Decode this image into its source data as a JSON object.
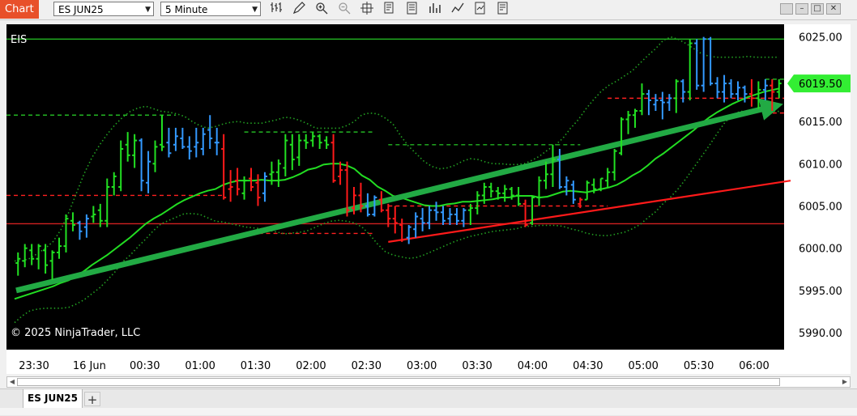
{
  "toolbar": {
    "chart_label": "Chart",
    "instrument_select": "ES JUN25",
    "interval_select": "5 Minute",
    "tools": [
      "bar-type-icon",
      "draw-icon",
      "zoom-in-icon",
      "zoom-out-icon",
      "crosshair-icon",
      "data-box-icon",
      "properties-icon",
      "chart-trader-icon",
      "indicators-icon",
      "strategies-icon",
      "templates-icon"
    ]
  },
  "window_controls": [
    "restore-icon",
    "minimize-icon",
    "maximize-icon",
    "close-icon"
  ],
  "bottom_tabs": {
    "active": "ES JUN25",
    "add_label": "+"
  },
  "chart_data": {
    "type": "candlestick",
    "instrument_label": "EIS",
    "copyright": "© 2025 NinjaTrader, LLC",
    "current_price": "6019.50",
    "colors": {
      "up": "#22e022",
      "down": "#ff1a1a",
      "inside": "#3399ff",
      "background": "#000000",
      "bollinger": "#22a022",
      "sma": "#22dd22"
    },
    "y_ticks": [
      "6025.00",
      "6015.00",
      "6010.00",
      "6005.00",
      "6000.00",
      "5995.00",
      "5990.00"
    ],
    "y_tick_values": [
      6025,
      6015,
      6010,
      6005,
      6000,
      5995,
      5990
    ],
    "ylim": [
      5988,
      6026.5
    ],
    "x_ticks": [
      "23:30",
      "16 Jun",
      "00:30",
      "01:00",
      "01:30",
      "02:00",
      "02:30",
      "03:00",
      "03:30",
      "04:00",
      "04:30",
      "05:00",
      "05:30",
      "06:00"
    ],
    "bars": [
      [
        5998.25,
        5999.5,
        5996.75,
        5998.75,
        "up"
      ],
      [
        5998.5,
        6000.5,
        5997.75,
        6000.0,
        "up"
      ],
      [
        5999.75,
        6000.5,
        5998.0,
        5998.75,
        "up"
      ],
      [
        5998.75,
        6000.5,
        5997.5,
        6000.25,
        "up"
      ],
      [
        5999.75,
        6000.5,
        5997.0,
        5998.0,
        "up"
      ],
      [
        5998.5,
        5999.75,
        5996.25,
        5999.5,
        "up"
      ],
      [
        5999.5,
        6001.25,
        5998.75,
        6000.25,
        "up"
      ],
      [
        6000.25,
        6004.0,
        5999.5,
        6003.5,
        "up"
      ],
      [
        6003.25,
        6004.25,
        6002.0,
        6002.75,
        "up"
      ],
      [
        6003.0,
        6003.25,
        6001.0,
        6002.0,
        "inside"
      ],
      [
        6002.5,
        6004.0,
        6001.25,
        6003.5,
        "inside"
      ],
      [
        6003.75,
        6005.0,
        6003.0,
        6004.0,
        "up"
      ],
      [
        6004.5,
        6005.25,
        6002.5,
        6003.25,
        "up"
      ],
      [
        6003.25,
        6008.25,
        6002.5,
        6007.25,
        "up"
      ],
      [
        6007.25,
        6009.0,
        6006.25,
        6008.5,
        "up"
      ],
      [
        6007.25,
        6012.75,
        6006.75,
        6011.75,
        "up"
      ],
      [
        6012.25,
        6013.75,
        6010.25,
        6011.0,
        "up"
      ],
      [
        6011.0,
        6013.5,
        6009.5,
        6012.75,
        "up"
      ],
      [
        6012.75,
        6013.0,
        6006.75,
        6008.0,
        "inside"
      ],
      [
        6007.75,
        6011.5,
        6006.5,
        6010.25,
        "inside"
      ],
      [
        6010.0,
        6012.75,
        6009.0,
        6012.0,
        "up"
      ],
      [
        6012.25,
        6015.75,
        6011.5,
        6012.0,
        "up"
      ],
      [
        6012.5,
        6014.25,
        6010.75,
        6011.25,
        "inside"
      ],
      [
        6012.25,
        6014.25,
        6011.5,
        6013.25,
        "inside"
      ],
      [
        6013.0,
        6014.25,
        6011.75,
        6012.0,
        "inside"
      ],
      [
        6012.0,
        6013.25,
        6010.5,
        6011.5,
        "inside"
      ],
      [
        6012.0,
        6014.25,
        6010.75,
        6012.5,
        "inside"
      ],
      [
        6011.75,
        6014.25,
        6011.0,
        6013.5,
        "inside"
      ],
      [
        6014.0,
        6015.75,
        6011.75,
        6013.0,
        "inside"
      ],
      [
        6012.5,
        6014.25,
        6011.0,
        6012.5,
        "inside"
      ],
      [
        6011.75,
        6013.5,
        6005.75,
        6006.0,
        "down"
      ],
      [
        6007.0,
        6009.25,
        6005.5,
        6007.25,
        "down"
      ],
      [
        6008.0,
        6009.5,
        6006.25,
        6007.0,
        "down"
      ],
      [
        6006.5,
        6008.5,
        6005.75,
        6008.0,
        "up"
      ],
      [
        6008.25,
        6009.5,
        6006.75,
        6007.25,
        "down"
      ],
      [
        6007.75,
        6008.75,
        6005.0,
        6006.0,
        "down"
      ],
      [
        6006.5,
        6009.0,
        6005.5,
        6008.5,
        "inside"
      ],
      [
        6008.75,
        6010.25,
        6007.5,
        6009.0,
        "up"
      ],
      [
        6009.0,
        6010.5,
        6007.25,
        6010.0,
        "up"
      ],
      [
        6009.5,
        6013.5,
        6008.5,
        6012.75,
        "up"
      ],
      [
        6012.25,
        6013.5,
        6009.25,
        6010.5,
        "up"
      ],
      [
        6010.75,
        6013.5,
        6009.75,
        6012.75,
        "up"
      ],
      [
        6012.75,
        6013.5,
        6011.75,
        6012.5,
        "up"
      ],
      [
        6012.75,
        6013.75,
        6012.0,
        6013.25,
        "up"
      ],
      [
        6013.25,
        6013.5,
        6011.75,
        6012.5,
        "up"
      ],
      [
        6012.75,
        6013.25,
        6011.75,
        6012.25,
        "up"
      ],
      [
        6012.5,
        6013.5,
        6007.75,
        6008.0,
        "down"
      ],
      [
        6008.5,
        6010.25,
        6007.5,
        6009.25,
        "down"
      ],
      [
        6009.25,
        6010.25,
        6003.75,
        6004.5,
        "down"
      ],
      [
        6004.75,
        6007.25,
        6004.0,
        6006.25,
        "down"
      ],
      [
        6006.25,
        6007.75,
        6004.25,
        6005.0,
        "down"
      ],
      [
        6005.0,
        6006.5,
        6003.75,
        6004.0,
        "inside"
      ],
      [
        6004.0,
        6006.25,
        6003.75,
        6006.0,
        "inside"
      ],
      [
        6005.75,
        6006.75,
        6004.25,
        6004.5,
        "down"
      ],
      [
        6004.5,
        6005.25,
        6002.5,
        6003.5,
        "down"
      ],
      [
        6003.5,
        6005.0,
        6001.75,
        6003.0,
        "down"
      ],
      [
        6002.75,
        6003.5,
        6000.75,
        6001.0,
        "down"
      ],
      [
        6001.25,
        6002.75,
        6000.5,
        6002.5,
        "inside"
      ],
      [
        6002.25,
        6004.25,
        6001.25,
        6003.75,
        "inside"
      ],
      [
        6003.5,
        6004.75,
        6002.0,
        6003.0,
        "inside"
      ],
      [
        6003.0,
        6005.0,
        6002.25,
        6004.5,
        "inside"
      ],
      [
        6004.5,
        6005.5,
        6003.25,
        6004.25,
        "inside"
      ],
      [
        6004.25,
        6005.0,
        6002.75,
        6003.25,
        "inside"
      ],
      [
        6003.5,
        6004.75,
        6002.75,
        6004.0,
        "inside"
      ],
      [
        6004.0,
        6004.75,
        6002.75,
        6003.25,
        "inside"
      ],
      [
        6003.25,
        6004.75,
        6002.5,
        6004.5,
        "inside"
      ],
      [
        6004.5,
        6005.25,
        6002.75,
        6004.75,
        "up"
      ],
      [
        6004.75,
        6006.75,
        6004.0,
        6006.25,
        "up"
      ],
      [
        6006.25,
        6007.75,
        6005.25,
        6007.25,
        "up"
      ],
      [
        6007.25,
        6007.75,
        6006.0,
        6006.75,
        "up"
      ],
      [
        6006.75,
        6007.25,
        6005.75,
        6006.5,
        "up"
      ],
      [
        6006.5,
        6007.5,
        6005.5,
        6007.0,
        "up"
      ],
      [
        6007.0,
        6007.25,
        6005.75,
        6006.25,
        "up"
      ],
      [
        6006.25,
        6007.25,
        6005.0,
        6005.25,
        "up"
      ],
      [
        6005.25,
        6005.75,
        6002.5,
        6002.75,
        "down"
      ],
      [
        6003.0,
        6006.25,
        6002.75,
        6006.0,
        "up"
      ],
      [
        6006.0,
        6008.5,
        6005.0,
        6008.0,
        "up"
      ],
      [
        6008.0,
        6010.25,
        6007.0,
        6008.75,
        "up"
      ],
      [
        6008.75,
        6012.25,
        6007.25,
        6010.5,
        "up"
      ],
      [
        6010.5,
        6011.75,
        6007.0,
        6007.25,
        "inside"
      ],
      [
        6007.25,
        6008.5,
        6006.25,
        6008.0,
        "inside"
      ],
      [
        6007.5,
        6008.0,
        6005.25,
        6005.75,
        "inside"
      ],
      [
        6005.25,
        6006.0,
        6004.75,
        6005.75,
        "down"
      ],
      [
        6005.75,
        6008.0,
        6005.75,
        6007.75,
        "up"
      ],
      [
        6007.5,
        6008.25,
        6006.5,
        6007.0,
        "up"
      ],
      [
        6007.0,
        6008.25,
        6006.75,
        6008.25,
        "up"
      ],
      [
        6008.0,
        6009.5,
        6007.25,
        6009.0,
        "up"
      ],
      [
        6009.0,
        6011.75,
        6008.0,
        6011.5,
        "up"
      ],
      [
        6011.25,
        6015.5,
        6011.0,
        6015.25,
        "up"
      ],
      [
        6015.25,
        6016.25,
        6013.5,
        6015.75,
        "up"
      ],
      [
        6015.75,
        6016.5,
        6014.25,
        6016.25,
        "up"
      ],
      [
        6016.25,
        6019.5,
        6015.75,
        6018.25,
        "up"
      ],
      [
        6018.25,
        6018.75,
        6015.75,
        6017.5,
        "inside"
      ],
      [
        6017.0,
        6018.25,
        6016.25,
        6017.5,
        "inside"
      ],
      [
        6017.5,
        6018.5,
        6015.25,
        6017.25,
        "inside"
      ],
      [
        6017.25,
        6018.25,
        6016.25,
        6017.75,
        "inside"
      ],
      [
        6017.75,
        6020.0,
        6016.0,
        6019.75,
        "up"
      ],
      [
        6019.75,
        6020.0,
        6017.25,
        6018.5,
        "inside"
      ],
      [
        6018.5,
        6024.75,
        6017.5,
        6024.25,
        "up"
      ],
      [
        6024.25,
        6024.75,
        6018.75,
        6019.25,
        "inside"
      ],
      [
        6019.25,
        6025.0,
        6018.5,
        6024.75,
        "inside"
      ],
      [
        6024.75,
        6025.0,
        6019.25,
        6019.5,
        "inside"
      ],
      [
        6019.5,
        6020.25,
        6017.75,
        6018.5,
        "inside"
      ],
      [
        6018.5,
        6020.5,
        6017.25,
        6019.5,
        "inside"
      ],
      [
        6019.5,
        6020.0,
        6017.75,
        6018.25,
        "inside"
      ],
      [
        6018.25,
        6019.75,
        6017.5,
        6019.0,
        "inside"
      ],
      [
        6019.0,
        6019.25,
        6017.25,
        6018.25,
        "inside"
      ],
      [
        6018.25,
        6020.0,
        6016.75,
        6017.75,
        "down"
      ],
      [
        6017.75,
        6019.75,
        6016.5,
        6018.75,
        "up"
      ],
      [
        6018.75,
        6020.0,
        6017.5,
        6019.25,
        "inside"
      ],
      [
        6019.25,
        6020.0,
        6016.25,
        6018.5,
        "down"
      ],
      [
        6018.5,
        6020.0,
        6017.75,
        6019.5,
        "up"
      ]
    ],
    "sma": [
      5994.0,
      5994.3,
      5994.6,
      5994.9,
      5995.2,
      5995.5,
      5995.9,
      5996.2,
      5996.7,
      5997.3,
      5998.0,
      5998.6,
      5999.2,
      5999.9,
      6000.6,
      6001.3,
      6002.1,
      6002.9,
      6003.5,
      6004.0,
      6004.6,
      6005.2,
      6005.7,
      6006.1,
      6006.5,
      6006.8,
      6007.0,
      6007.5,
      6007.8,
      6008.0,
      6008.0,
      6008.0,
      6008.1,
      6008.0,
      6008.0,
      6008.1,
      6008.4,
      6008.8,
      6009.3,
      6009.5,
      6009.9,
      6010.0,
      6010.0,
      6009.8,
      6009.4,
      6008.6,
      6008.1,
      6007.3,
      6006.8,
      6006.2,
      6006.0,
      6005.7,
      6005.4,
      6005.1,
      6005.0,
      6005.0,
      6005.2,
      6005.3,
      6005.5,
      6005.5,
      6005.6,
      6005.7,
      6005.8,
      6006.0,
      6006.0,
      6006.2,
      6006.2,
      6006.2,
      6006.0,
      6006.1,
      6006.4,
      6006.7,
      6006.8,
      6006.7,
      6006.6,
      6006.8,
      6007.0,
      6007.2,
      6007.5,
      6008.0,
      6008.6,
      6009.1,
      6009.8,
      6010.6,
      6011.2,
      6011.9,
      6012.6,
      6013.3,
      6014.0,
      6014.8,
      6015.5,
      6016.1,
      6016.6,
      6017.1,
      6017.5,
      6017.9,
      6018.2,
      6018.5,
      6018.7,
      6018.9
    ],
    "bb_upper": [
      5998.5,
      5998.5,
      5998.8,
      5999.4,
      6000.0,
      6000.8,
      6002.2,
      6004.2,
      6006.5,
      6008.8,
      6010.7,
      6012.2,
      6013.5,
      6014.6,
      6015.5,
      6016.2,
      6016.6,
      6016.8,
      6016.5,
      6016.2,
      6016.1,
      6015.9,
      6015.6,
      6015.0,
      6014.5,
      6014.2,
      6014.4,
      6014.7,
      6014.9,
      6015.0,
      6014.8,
      6014.8,
      6014.8,
      6015.0,
      6015.2,
      6015.5,
      6015.4,
      6015.1,
      6014.7,
      6014.2,
      6014.2,
      6014.2,
      6014.2,
      6014.5,
      6015.0,
      6015.8,
      6016.0,
      6015.9,
      6015.4,
      6014.7,
      6013.3,
      6012.1,
      6011.2,
      6010.3,
      6009.7,
      6009.4,
      6009.5,
      6009.8,
      6010.3,
      6010.6,
      6010.5,
      6010.2,
      6010.0,
      6010.0,
      6009.9,
      6009.9,
      6010.0,
      6010.4,
      6010.9,
      6011.6,
      6012.2,
      6013.0,
      6014.2,
      6015.2,
      6016.5,
      6017.6,
      6018.6,
      6019.3,
      6019.8,
      6020.4,
      6021.0,
      6021.9,
      6022.8,
      6023.6,
      6024.6,
      6025.0,
      6024.7,
      6024.2,
      6023.6,
      6023.0,
      6022.7,
      6022.6,
      6022.6,
      6022.6,
      6022.6,
      6022.7,
      6022.6,
      6022.6,
      6022.6,
      6022.6
    ],
    "bb_lower": [
      5991.2,
      5992.0,
      5992.6,
      5992.8,
      5992.9,
      5992.9,
      5992.9,
      5993.0,
      5993.4,
      5993.9,
      5994.6,
      5995.3,
      5996.2,
      5997.2,
      5998.4,
      5999.2,
      6000.2,
      6001.1,
      6002.1,
      6002.9,
      6003.3,
      6003.7,
      6004.1,
      6004.1,
      6004.0,
      6003.6,
      6003.2,
      6003.1,
      6002.9,
      6002.7,
      6002.5,
      6002.4,
      6002.3,
      6002.1,
      6001.9,
      6001.7,
      6001.8,
      6001.9,
      6002.1,
      6002.5,
      6002.9,
      6003.2,
      6003.3,
      6003.2,
      6003.0,
      6002.5,
      6001.6,
      6000.5,
      5999.6,
      5999.2,
      5999.0,
      5998.8,
      5998.9,
      5999.2,
      5999.6,
      6000.0,
      6000.4,
      6000.8,
      6001.1,
      6001.4,
      6001.6,
      6001.8,
      6002.0,
      6002.1,
      6002.2,
      6002.3,
      6002.6,
      6002.6,
      6002.7,
      6002.7,
      6002.7,
      6002.6,
      6002.3,
      6002.1,
      6001.8,
      6001.6,
      6001.5,
      6001.5,
      6001.7,
      6001.9,
      6002.3,
      6002.8,
      6003.6,
      6004.3,
      6005.3,
      6006.1,
      6007.1,
      6008.3,
      6009.6,
      6010.9,
      6012.2,
      6013.6,
      6014.9,
      6015.8,
      6016.2,
      6016.2,
      6016.2,
      6016.2,
      6016.2,
      6016.2
    ],
    "levels": [
      {
        "type": "solid",
        "color": "#22b422",
        "price": 6024.75,
        "from": 0,
        "to": 117
      },
      {
        "type": "solid",
        "color": "#d22020",
        "price": 6002.9,
        "from": 0,
        "to": 117
      },
      {
        "type": "dashed",
        "color": "#22b422",
        "price": 6015.75,
        "from": 0,
        "to": 23
      },
      {
        "type": "dashed",
        "color": "#ff2020",
        "price": 6006.25,
        "from": 0,
        "to": 30
      },
      {
        "type": "dashed",
        "color": "#22b422",
        "price": 6013.75,
        "from": 33,
        "to": 52
      },
      {
        "type": "dashed",
        "color": "#ff2020",
        "price": 6001.75,
        "from": 33,
        "to": 52
      },
      {
        "type": "dashed",
        "color": "#22b422",
        "price": 6012.25,
        "from": 54,
        "to": 82
      },
      {
        "type": "dashed",
        "color": "#ff2020",
        "price": 6005.0,
        "from": 54,
        "to": 86
      },
      {
        "type": "dashed",
        "color": "#ff2020",
        "price": 6017.75,
        "from": 86,
        "to": 115
      },
      {
        "type": "dashed",
        "color": "#22b422",
        "price": 6020.0,
        "from": 109,
        "to": 115
      },
      {
        "type": "dashed",
        "color": "#ff2020",
        "price": 6016.0,
        "from": 109,
        "to": 115
      }
    ],
    "trendlines": [
      {
        "color": "#ff1a1a",
        "x0": 54,
        "y0": 6000.75,
        "x1": 117,
        "y1": 6008.0
      },
      {
        "color": "#22aa44",
        "x0": 0,
        "y0": 5995.0,
        "x1": 110,
        "y1": 6016.75,
        "arrow": true
      }
    ]
  }
}
